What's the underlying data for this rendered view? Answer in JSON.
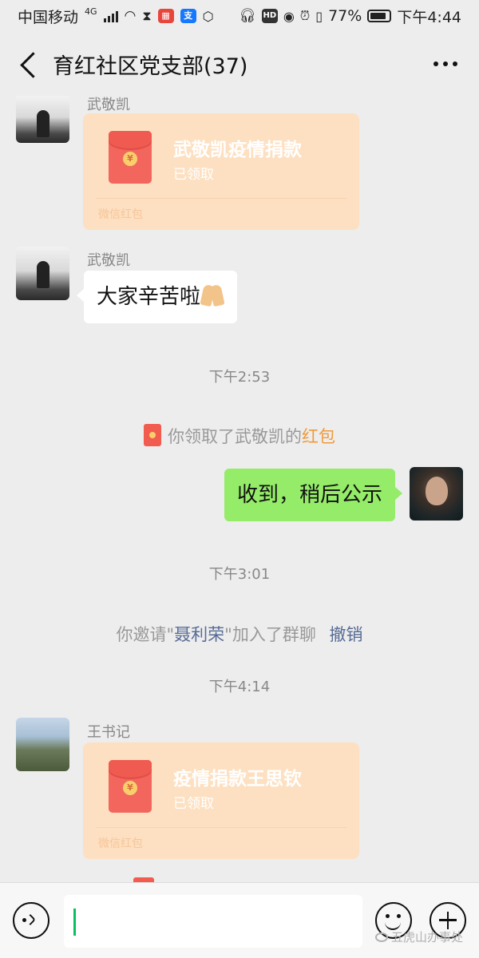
{
  "status_bar": {
    "carrier": "中国移动",
    "network": "4G",
    "battery": "77%",
    "time": "下午4:44"
  },
  "header": {
    "title": "育红社区党支部(37)"
  },
  "messages": {
    "m1": {
      "sender": "武敬凯",
      "rp_title": "武敬凯疫情捐款",
      "rp_status": "已领取",
      "rp_footer": "微信红包"
    },
    "m2": {
      "sender": "武敬凯",
      "text": "大家辛苦啦"
    },
    "t1": "下午2:53",
    "sys1": {
      "prefix": "你领取了武敬凯的",
      "link": "红包"
    },
    "m3": {
      "text": "收到，稍后公示"
    },
    "t2": "下午3:01",
    "sys2": {
      "prefix": "你邀请\"",
      "name": "聂利荣",
      "suffix": "\"加入了群聊",
      "action": "撤销"
    },
    "t3": "下午4:14",
    "m4": {
      "sender": "王书记",
      "rp_title": "疫情捐款王思钦",
      "rp_status": "已领取",
      "rp_footer": "微信红包"
    }
  },
  "input_bar": {
    "value": "",
    "watermark": "五虎山办事处"
  },
  "colors": {
    "bubble_green": "#95ec69",
    "redpacket_bg": "#fde0c1",
    "link_orange": "#f09a3a",
    "link_blue": "#576b95",
    "caret_green": "#07c160"
  }
}
